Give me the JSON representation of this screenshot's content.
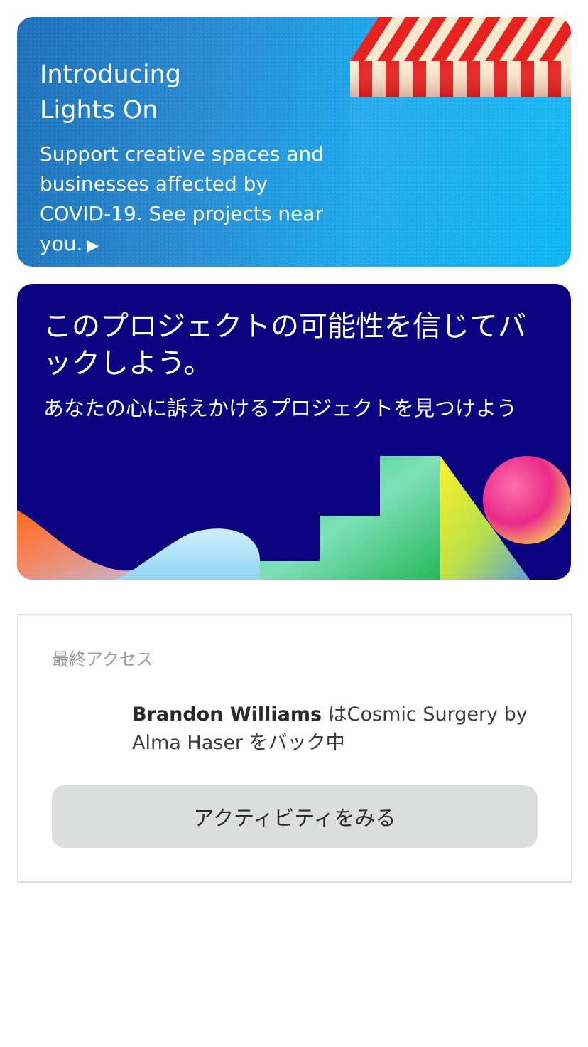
{
  "lights_on_card": {
    "title_line1": "Introducing",
    "title_line2": "Lights On",
    "description": "Support creative spaces and businesses affected by COVID-19. See projects near you.",
    "play_glyph": "▶",
    "icon": "play-icon",
    "colors": {
      "gradient_start": "#1f72bc",
      "gradient_end": "#0fbaf9",
      "awning_red": "#e8221f",
      "awning_cream": "#fbe9cf"
    }
  },
  "back_project_card": {
    "headline": "このプロジェクトの可能性を信じてバックしよう。",
    "subline": "あなたの心に訴えかけるプロジェクトを見つけよう",
    "colors": {
      "background": "#0b0280"
    }
  },
  "activity": {
    "heading": "最終アクセス",
    "feed": {
      "user_name": "Brandon Williams",
      "connector": " は",
      "project": "Cosmic Surgery by Alma Haser",
      "suffix": " をバック中"
    },
    "button_label": "アクティビティをみる"
  }
}
